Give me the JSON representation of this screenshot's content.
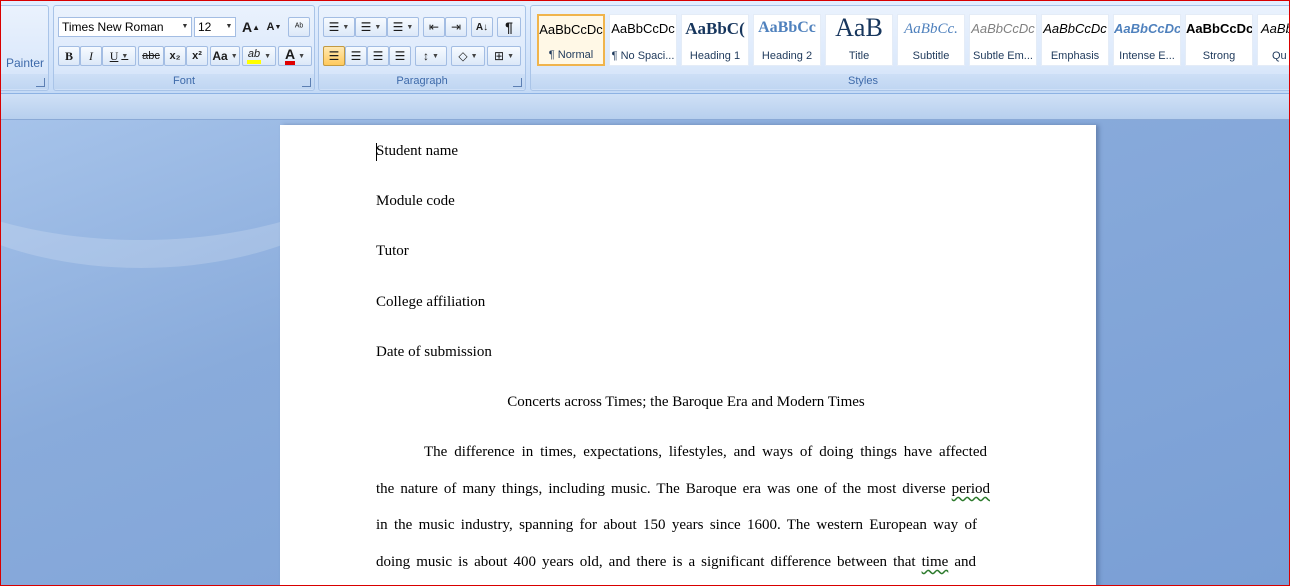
{
  "ribbon": {
    "clipboard": {
      "format_painter_label": "Painter"
    },
    "font": {
      "group_label": "Font",
      "font_name": "Times New Roman",
      "font_size": "12",
      "grow_font": "A",
      "shrink_font": "A",
      "clear_formatting": "ᴬᵇ",
      "bold": "B",
      "italic": "I",
      "underline": "U",
      "strikethrough": "abc",
      "subscript": "x₂",
      "superscript": "x²",
      "change_case": "Aa",
      "highlight": "ab",
      "font_color": "A",
      "highlight_color": "#ffff00",
      "font_color_value": "#e00000"
    },
    "paragraph": {
      "group_label": "Paragraph",
      "bullets": "☰",
      "numbering": "☰",
      "multilevel": "☰",
      "decrease_indent": "⇤",
      "increase_indent": "⇥",
      "sort": "A↓",
      "show_marks": "¶",
      "align_left": "☰",
      "align_center": "☰",
      "align_right": "☰",
      "justify": "☰",
      "line_spacing": "↕",
      "shading": "◇",
      "borders": "⊞"
    },
    "styles": {
      "group_label": "Styles",
      "items": [
        {
          "sample": "AaBbCcDc",
          "name": "¶ Normal"
        },
        {
          "sample": "AaBbCcDc",
          "name": "¶ No Spaci..."
        },
        {
          "sample": "AaBbC(",
          "name": "Heading 1"
        },
        {
          "sample": "AaBbCc",
          "name": "Heading 2"
        },
        {
          "sample": "AaB",
          "name": "Title"
        },
        {
          "sample": "AaBbCc.",
          "name": "Subtitle"
        },
        {
          "sample": "AaBbCcDc",
          "name": "Subtle Em..."
        },
        {
          "sample": "AaBbCcDc",
          "name": "Emphasis"
        },
        {
          "sample": "AaBbCcDc",
          "name": "Intense E..."
        },
        {
          "sample": "AaBbCcDc",
          "name": "Strong"
        },
        {
          "sample": "AaBbC",
          "name": "Qu"
        }
      ]
    }
  },
  "document": {
    "header_lines": [
      "Student name",
      "Module code",
      "Tutor",
      "College affiliation",
      "Date of submission"
    ],
    "title": "Concerts across Times; the Baroque Era and Modern Times",
    "body": {
      "line1": "The difference in times, expectations, lifestyles, and ways of doing things have affected",
      "line2_main": "the nature of many things, including music. The Baroque era was one of the most diverse",
      "line2_flag": "period",
      "line3": "in the music industry, spanning for about 150 years since 1600. The western European way of",
      "line4_main": "doing music is about 400 years old, and there is a significant difference between that",
      "line4_flag": "time",
      "line4_end": "and"
    }
  }
}
